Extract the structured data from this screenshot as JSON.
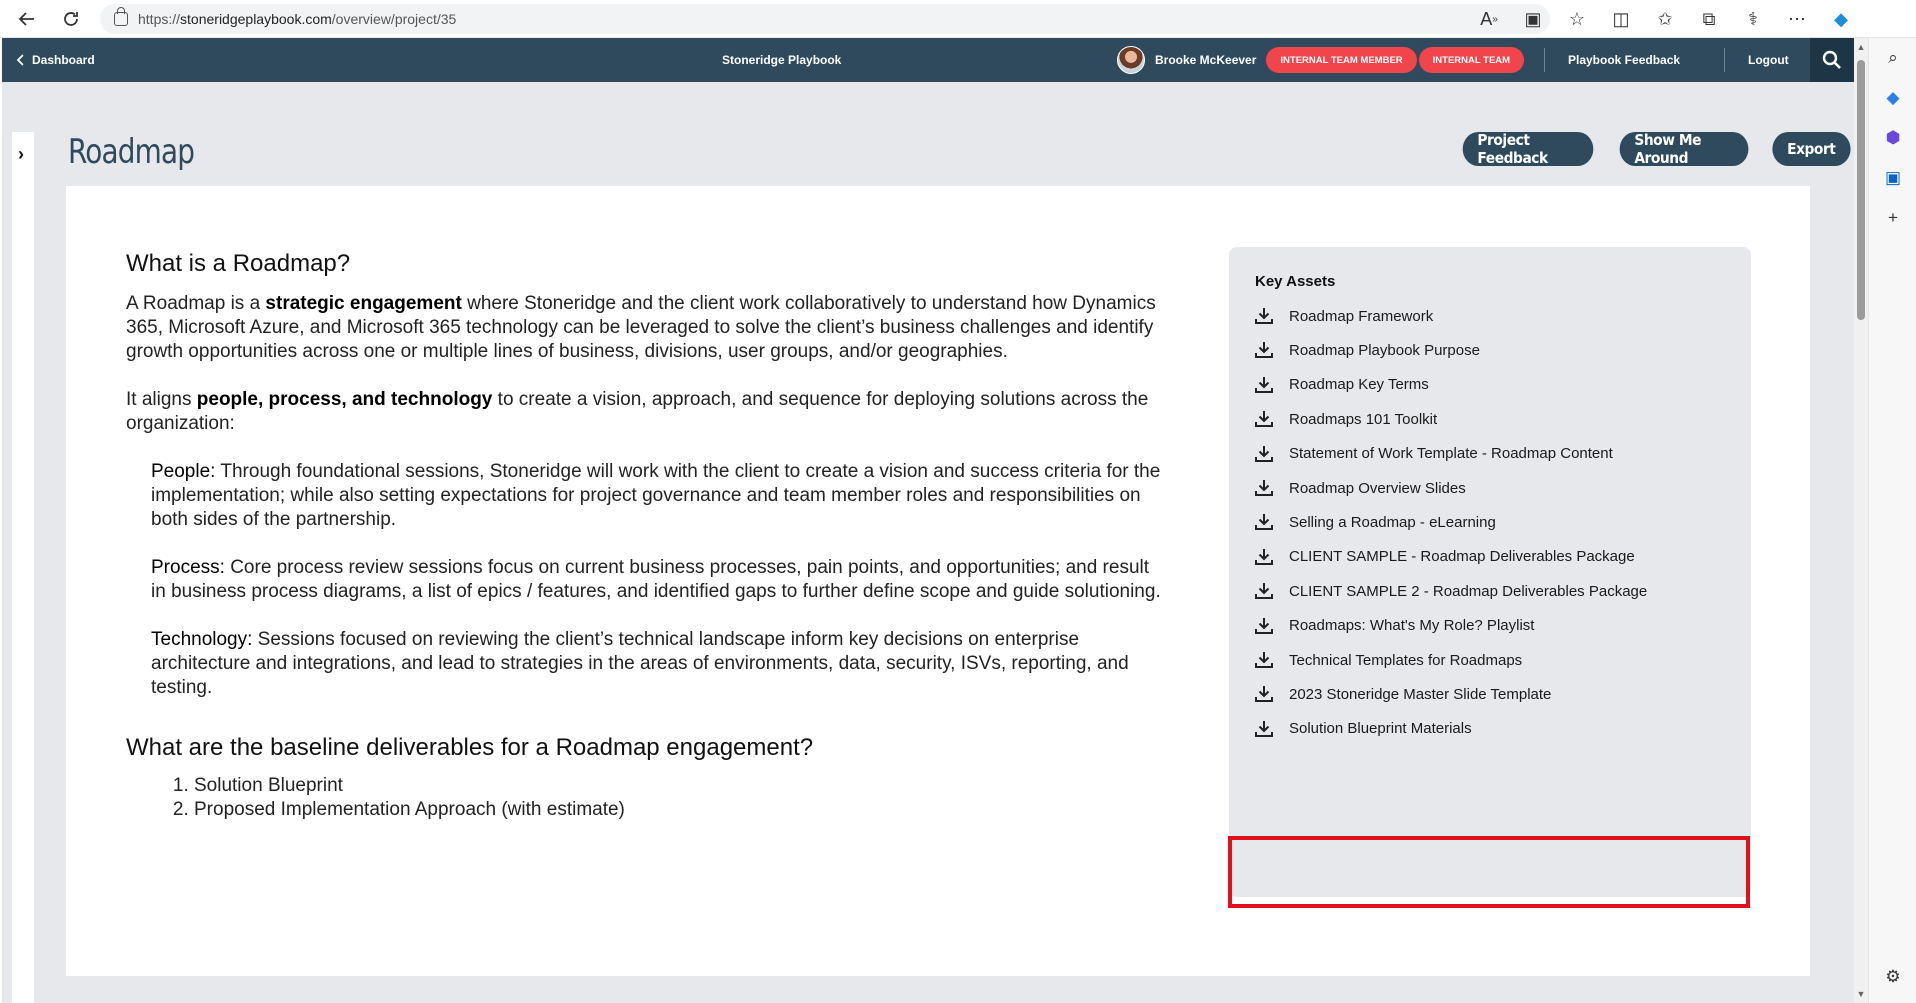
{
  "browser": {
    "url_prefix": "https://",
    "url_host": "stoneridgeplaybook.com",
    "url_path": "/overview/project/35"
  },
  "header": {
    "dashboard": "Dashboard",
    "title": "Stoneridge Playbook",
    "user_name": "Brooke McKeever",
    "badges": [
      "INTERNAL TEAM MEMBER",
      "INTERNAL TEAM"
    ],
    "feedback": "Playbook Feedback",
    "logout": "Logout"
  },
  "page": {
    "title": "Roadmap",
    "buttons": [
      "Project Feedback",
      "Show Me Around",
      "Export"
    ]
  },
  "content": {
    "heading1": "What is a Roadmap?",
    "p1_before": "A Roadmap is a ",
    "p1_bold": "strategic engagement",
    "p1_after": " where Stoneridge and the client work collaboratively to understand how Dynamics 365, Microsoft Azure, and Microsoft 365 technology can be leveraged to solve the client’s business challenges and identify growth opportunities across one or multiple lines of business, divisions, user groups, and/or geographies.",
    "p2_before": "It aligns ",
    "p2_bold": "people, process, and technology",
    "p2_after": " to create a vision, approach, and sequence for deploying solutions across the organization:",
    "people_label": "People:",
    "people_text": " Through foundational sessions, Stoneridge will work with the client to create a vision and success criteria for the implementation; while also setting expectations for project governance and team member roles and responsibilities on both sides of the partnership.",
    "process_label": "Process:",
    "process_text": " Core process review sessions focus on current business processes, pain points, and opportunities; and result in business process diagrams, a list of epics / features, and identified gaps to further define scope and guide solutioning.",
    "tech_label": "Technology:",
    "tech_text": " Sessions focused on reviewing the client’s technical landscape inform key decisions on enterprise architecture and integrations, and lead to strategies in the areas of environments, data, security, ISVs, reporting, and testing.",
    "heading2": "What are the baseline deliverables for a Roadmap engagement?",
    "deliverables": [
      "Solution Blueprint",
      "Proposed Implementation Approach (with estimate)"
    ]
  },
  "assets": {
    "heading": "Key Assets",
    "items": [
      "Roadmap Framework",
      "Roadmap Playbook Purpose",
      "Roadmap Key Terms",
      "Roadmaps 101 Toolkit",
      "Statement of Work Template - Roadmap Content",
      "Roadmap Overview Slides",
      "Selling a Roadmap - eLearning",
      "CLIENT SAMPLE - Roadmap Deliverables Package",
      "CLIENT SAMPLE 2 - Roadmap Deliverables Package",
      "Roadmaps: What's My Role? Playlist",
      "Technical Templates for Roadmaps",
      "2023 Stoneridge Master Slide Template",
      "Solution Blueprint Materials"
    ]
  },
  "colors": {
    "header_bg": "#2e4a5c",
    "badge": "#f0454b",
    "highlight": "#e0101d"
  }
}
